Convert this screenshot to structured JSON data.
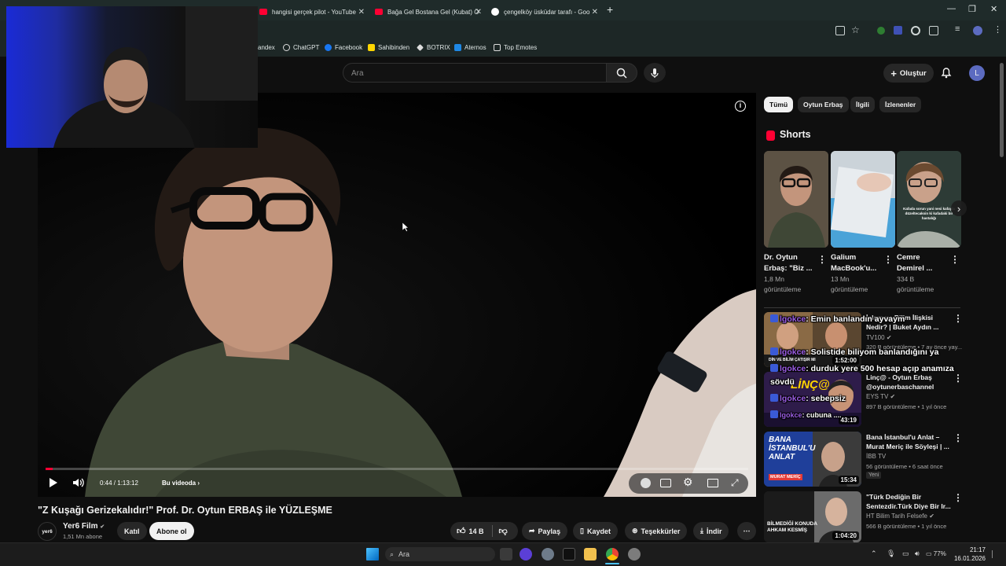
{
  "browser": {
    "tabs": [
      {
        "title": "hangisi gerçek pilot - YouTube",
        "favicon": "youtube-icon"
      },
      {
        "title": "Bağa Gel Bostana Gel (Kubat) Ö",
        "favicon": "youtube-icon"
      },
      {
        "title": "çengelköy üsküdar tarafı - Goo",
        "favicon": "google-icon"
      }
    ],
    "bookmarks": [
      "andex",
      "ChatGPT",
      "Facebook",
      "Sahibinden",
      "BOTRIX",
      "Aternos",
      "Top Emotes"
    ]
  },
  "header": {
    "search_placeholder": "Ara",
    "create_label": "Oluştur",
    "avatar_letter": "L"
  },
  "player": {
    "time": "0:44 / 1:13:12",
    "chapter": "Bu videoda",
    "progress_fraction": 0.01
  },
  "video": {
    "title": "\"Z Kuşağı Gerizekalıdır!\" Prof. Dr. Oytun ERBAŞ ile YÜZLEŞME",
    "channel": "Yer6 Film",
    "subscribers": "1,51 Mn abone",
    "join_label": "Katıl",
    "subscribe_label": "Abone ol",
    "channel_logo_text": "yer6",
    "likes": "14 B",
    "share_label": "Paylaş",
    "save_label": "Kaydet",
    "thanks_label": "Teşekkürler",
    "download_label": "İndir"
  },
  "chips": [
    "Tümü",
    "Oytun Erbaş",
    "İlgili",
    "İzlenenler"
  ],
  "shorts": {
    "heading": "Shorts",
    "items": [
      {
        "title": "Dr. Oytun Erbaş: \"Biz ...",
        "views": "1,8 Mn görüntüleme"
      },
      {
        "title": "Galium MacBook'u...",
        "views": "13 Mn görüntüleme"
      },
      {
        "title": "Cemre Demirel ...",
        "views": "334 B görüntüleme"
      }
    ],
    "thumb3_caption": "Kafada sorun yani nesi kafayla düzeltecaksin ki kafadaki bir hastalığı"
  },
  "related": [
    {
      "title": "İslam ve Bilim İlişkisi Nedir? | Buket Aydın ...",
      "channel": "TV100",
      "meta": "320 B görüntüleme • 7 ay önce yay...",
      "duration": "1:52:00",
      "thumb_text": "DİN VE BİLİM ÇATIŞIR MI"
    },
    {
      "title": "Linç@ - Oytun Erbaş @oytunerbaschannel",
      "channel": "EYS TV",
      "meta": "897 B görüntüleme • 1 yıl önce",
      "duration": "43:19",
      "thumb_text": "LİNÇ@"
    },
    {
      "title": "Bana İstanbul'u Anlat – Murat Meriç ile Söyleşi | ...",
      "channel": "İBB TV",
      "meta": "56 görüntüleme • 6 saat önce",
      "badge": "Yeni",
      "duration": "15:34",
      "thumb_text": "BANA İSTANBUL'U ANLAT",
      "thumb_sub": "MURAT MERİÇ"
    },
    {
      "title": "\"Türk Dediğin Bir Sentezdir.Türk Diye Bir Ir...",
      "channel": "HT Bilim Tarih Felsefe",
      "meta": "566 B görüntüleme • 1 yıl önce",
      "duration": "1:04:20",
      "thumb_text": "BİLMEDİĞİ KONUDA AHKAM KESMİŞ"
    }
  ],
  "chat_overlay": [
    {
      "user": "lgokce",
      "msg": ": Emin banlandın ayvaym"
    },
    {
      "user": "lgokce",
      "msg": ": Solistide biliyom banlandığını ya"
    },
    {
      "user": "lgokce",
      "msg": ": durduk yere 500 hesap açıp anamıza"
    },
    {
      "user": "",
      "msg": "sövdü"
    },
    {
      "user": "lgokce",
      "msg": ": sebepsiz"
    },
    {
      "user": "lgokce",
      "msg": ": cubuna ...."
    }
  ],
  "taskbar": {
    "search_placeholder": "Ara",
    "battery": "77%",
    "time": "21:17",
    "date": "16.01.2026"
  },
  "colors": {
    "yt_red": "#ff0033",
    "chip_bg": "#272727",
    "chat_user": "#9b5de5"
  }
}
